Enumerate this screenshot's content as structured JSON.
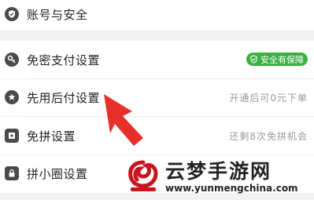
{
  "settings": {
    "items": [
      {
        "label": "账号与安全",
        "icon": "shield-check-icon",
        "value": ""
      },
      {
        "label": "免密支付设置",
        "icon": "key-icon",
        "badge": "安全有保障"
      },
      {
        "label": "先用后付设置",
        "icon": "badge-star-icon",
        "value": "开通后可0元下单"
      },
      {
        "label": "免拼设置",
        "icon": "coupon-icon",
        "value": "还剩8次免拼机会"
      },
      {
        "label": "拼小圈设置",
        "icon": "lock-icon",
        "value": ""
      }
    ]
  },
  "watermark": {
    "title": "云梦手游网",
    "url": "www.yunmengchina.com"
  },
  "colors": {
    "badge_green": "#3cb043",
    "arrow_red": "#e8302a",
    "icon_gray": "#4a4a4a"
  }
}
